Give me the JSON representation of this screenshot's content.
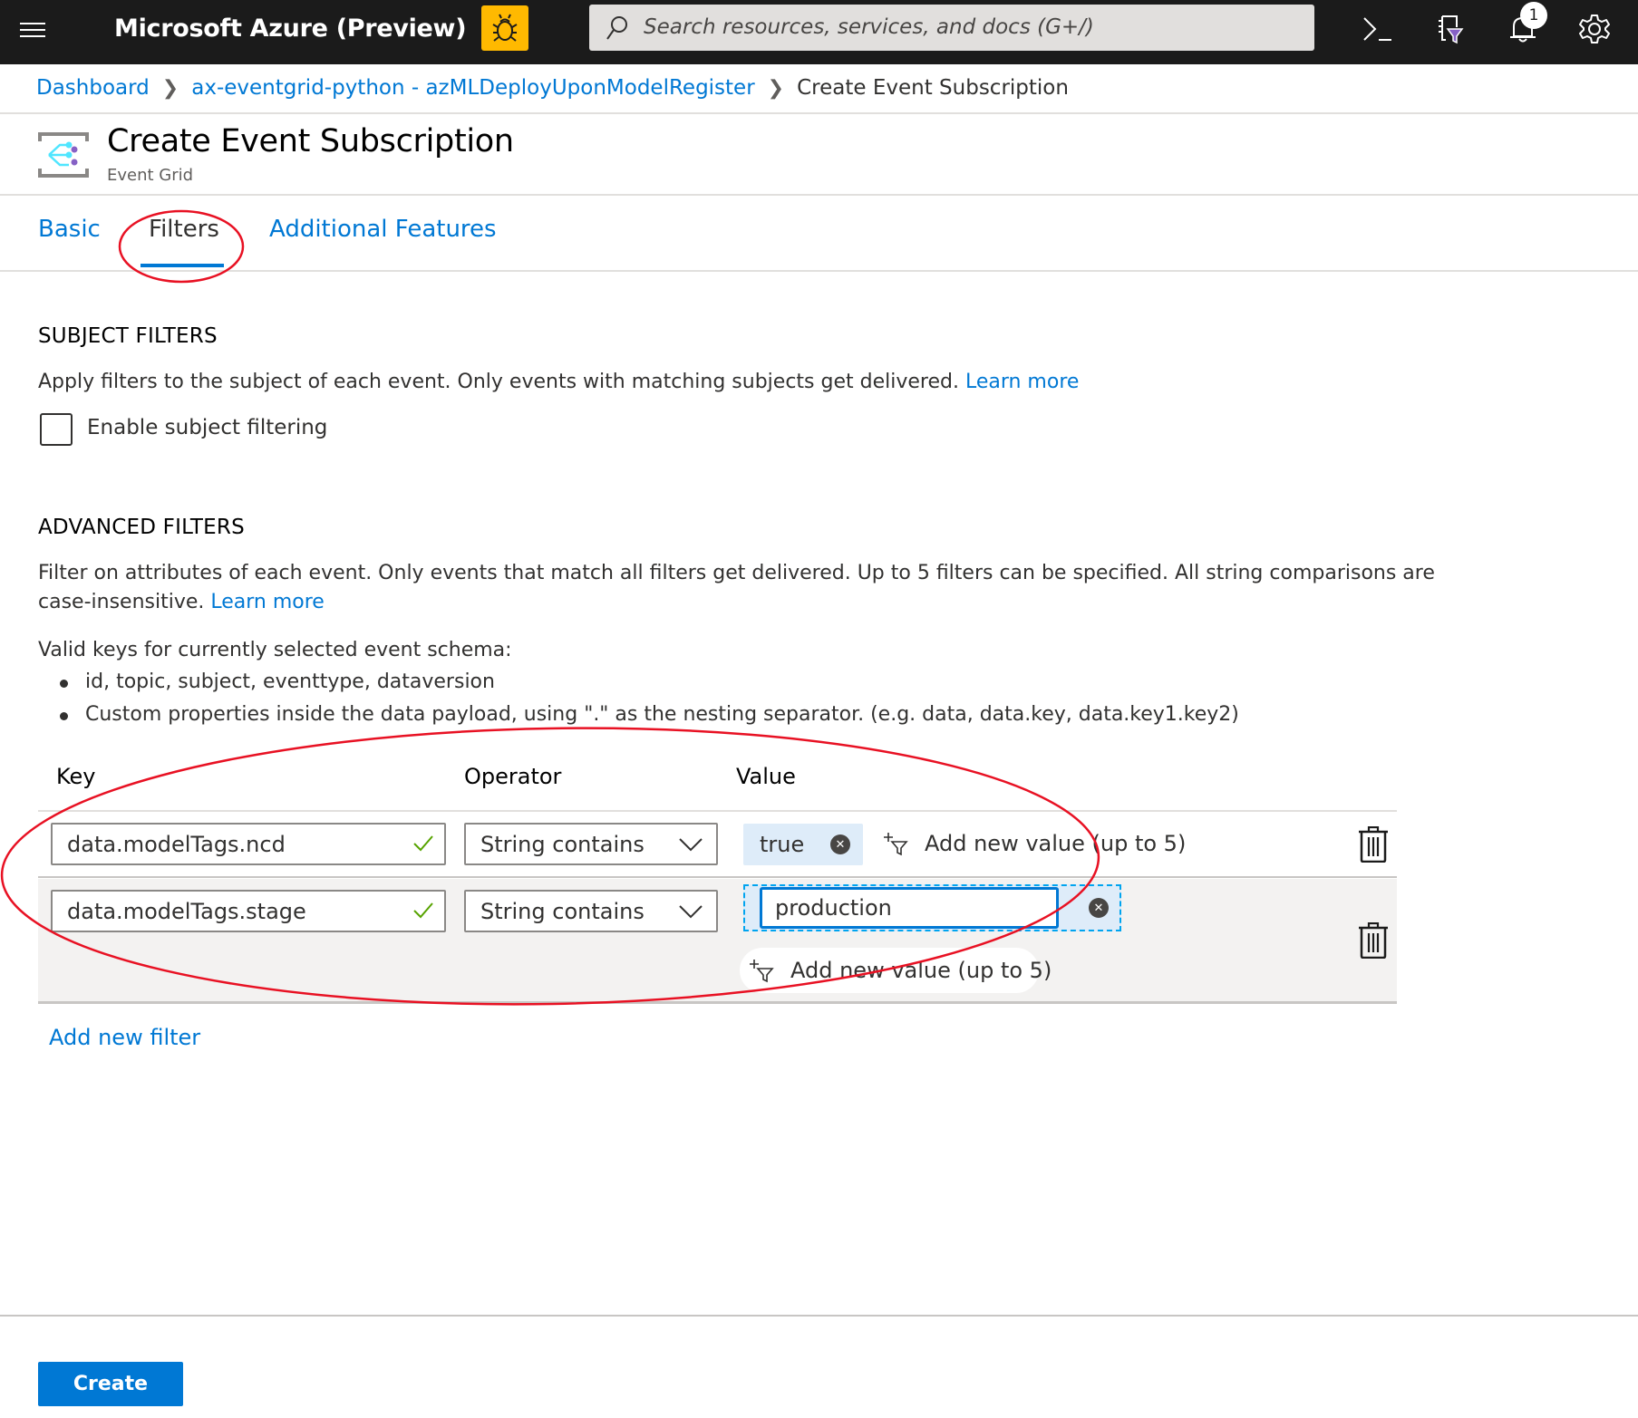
{
  "topbar": {
    "menu_icon": "hamburger-icon",
    "brand": "Microsoft Azure (Preview)",
    "bug_icon": "bug-icon",
    "search_placeholder": "Search resources, services, and docs (G+/)",
    "icons": [
      "cloud-shell-icon",
      "directory-filter-icon",
      "notifications-icon",
      "settings-icon"
    ],
    "notification_count": "1",
    "colors": {
      "bar": "#1b1b1b",
      "preview_badge": "#ffb900"
    }
  },
  "breadcrumb": {
    "items": [
      "Dashboard",
      "ax-eventgrid-python - azMLDeployUponModelRegister"
    ],
    "current": "Create Event Subscription"
  },
  "header": {
    "title": "Create Event Subscription",
    "subtitle": "Event Grid",
    "icon": "event-grid-icon"
  },
  "tabs": [
    {
      "label": "Basic",
      "active": false
    },
    {
      "label": "Filters",
      "active": true
    },
    {
      "label": "Additional Features",
      "active": false
    }
  ],
  "subject_filters": {
    "title": "SUBJECT FILTERS",
    "description": "Apply filters to the subject of each event. Only events with matching subjects get delivered.",
    "learn_more": "Learn more",
    "checkbox_label": "Enable subject filtering",
    "checkbox_checked": false
  },
  "advanced_filters": {
    "title": "ADVANCED FILTERS",
    "description_line1": "Filter on attributes of each event. Only events that match all filters get delivered. Up to 5 filters can be specified. All string comparisons are",
    "description_line2": "case-insensitive.",
    "learn_more": "Learn more",
    "valid_keys_label": "Valid keys for currently selected event schema:",
    "valid_keys": [
      "id, topic, subject, eventtype, dataversion",
      "Custom properties inside the data payload, using \".\" as the nesting separator. (e.g. data, data.key, data.key1.key2)"
    ],
    "columns": {
      "key": "Key",
      "operator": "Operator",
      "value": "Value"
    },
    "filters": [
      {
        "key": "data.modelTags.ncd",
        "operator": "String contains",
        "values": [
          "true"
        ],
        "add_value": "Add new value (up to 5)"
      },
      {
        "key": "data.modelTags.stage",
        "operator": "String contains",
        "values": [
          "production"
        ],
        "add_value": "Add new value (up to 5)"
      }
    ],
    "add_filter": "Add new filter"
  },
  "footer": {
    "create": "Create"
  },
  "colors": {
    "accent": "#0078d4",
    "valid_check": "#57a300",
    "annotation": "#e81123"
  }
}
